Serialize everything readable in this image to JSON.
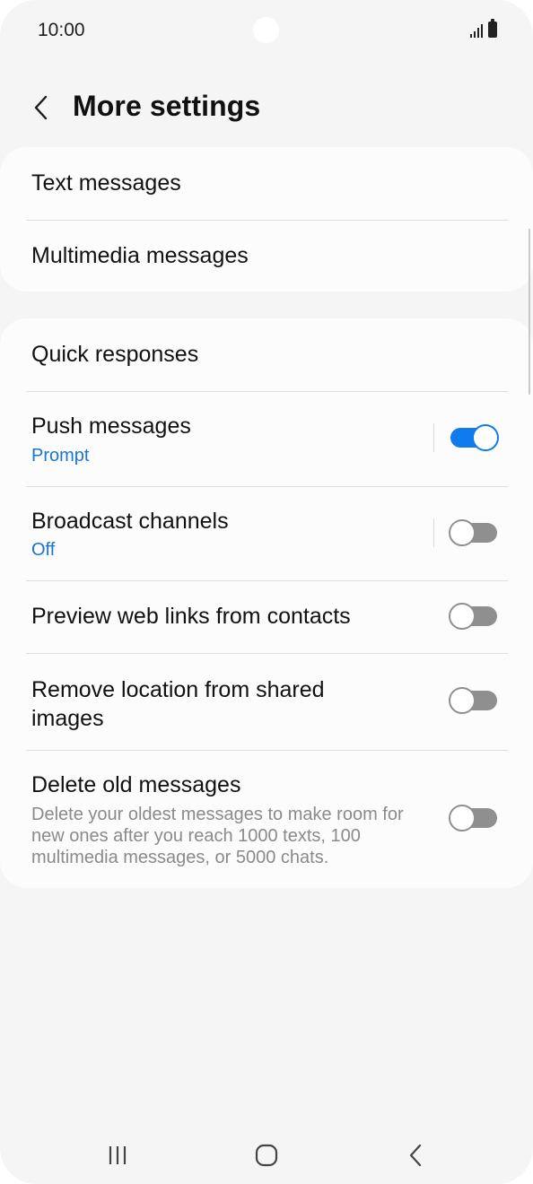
{
  "status_bar": {
    "time": "10:00"
  },
  "header": {
    "title": "More settings"
  },
  "group1": {
    "items": [
      {
        "title": "Text messages"
      },
      {
        "title": "Multimedia messages"
      }
    ]
  },
  "group2": {
    "quick_responses": {
      "title": "Quick responses"
    },
    "push_messages": {
      "title": "Push messages",
      "subtitle": "Prompt",
      "toggle_on": true
    },
    "broadcast_channels": {
      "title": "Broadcast channels",
      "subtitle": "Off",
      "toggle_on": false
    },
    "preview_links": {
      "title": "Preview web links from contacts",
      "toggle_on": false
    },
    "remove_location": {
      "title_line1": "Remove location from shared",
      "title_line2": "images",
      "toggle_on": false
    },
    "delete_old": {
      "title": "Delete old messages",
      "description": "Delete your oldest messages to make room for new ones after you reach 1000 texts, 100 multimedia messages, or 5000 chats.",
      "toggle_on": false
    }
  },
  "colors": {
    "accent": "#0f7bec",
    "subtitle_blue": "#1776d2",
    "background": "#f5f5f5",
    "card": "#fcfcfc"
  },
  "icons": [
    "back-icon",
    "signal-icon",
    "battery-icon",
    "recents-icon",
    "home-icon",
    "nav-back-icon"
  ]
}
